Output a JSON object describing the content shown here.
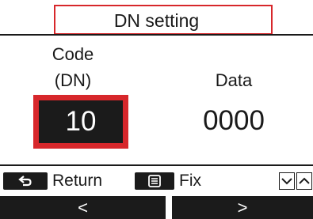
{
  "header": {
    "title": "DN setting"
  },
  "main": {
    "code_label_line1": "Code",
    "code_label_line2": "(DN)",
    "data_label": "Data",
    "code_value": "10",
    "data_value": "0000"
  },
  "soft_keys": {
    "return_label": "Return",
    "fix_label": "Fix",
    "return_icon": "return-arrow-icon",
    "fix_icon": "menu-icon",
    "down_icon": "chevron-down-icon",
    "up_icon": "chevron-up-icon"
  },
  "nav": {
    "left_label": "<",
    "right_label": ">"
  },
  "colors": {
    "highlight": "#d7272b",
    "dark": "#1b1b1b",
    "background": "#ffffff"
  }
}
